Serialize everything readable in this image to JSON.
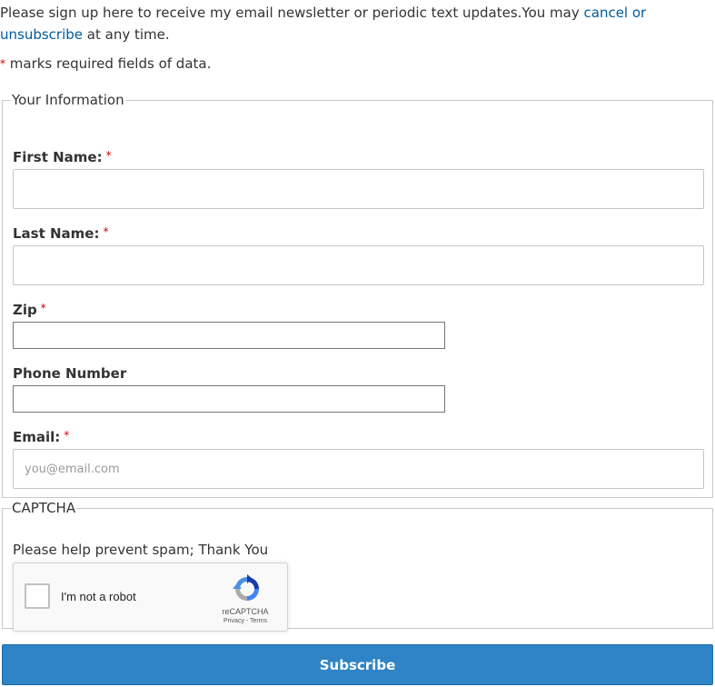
{
  "intro": {
    "text": "Please sign up here to receive my email newsletter or periodic text updates.You may ",
    "link": "cancel or unsubscribe",
    "suffix": " at any time."
  },
  "required_note": {
    "star": "*",
    "text": " marks required fields of data."
  },
  "your_information": {
    "legend": "Your Information",
    "first_name": {
      "label": "First Name:",
      "required": "*",
      "value": ""
    },
    "last_name": {
      "label": "Last Name:",
      "required": "*",
      "value": ""
    },
    "zip": {
      "label": "Zip",
      "required": "*",
      "value": ""
    },
    "phone": {
      "label": "Phone Number",
      "value": ""
    },
    "email": {
      "label": "Email:",
      "required": "*",
      "value": "",
      "placeholder": "you@email.com"
    }
  },
  "captcha": {
    "legend": "CAPTCHA",
    "instructions": "Please help prevent spam; Thank You",
    "checkbox_label": "I'm not a robot",
    "brand": "reCAPTCHA",
    "terms": "Privacy - Terms",
    "icon": "recaptcha-logo-icon"
  },
  "submit": {
    "label": "Subscribe"
  },
  "colors": {
    "link": "#005a9c",
    "required": "#cc0000",
    "button": "#2e84c6",
    "text": "#333333"
  }
}
